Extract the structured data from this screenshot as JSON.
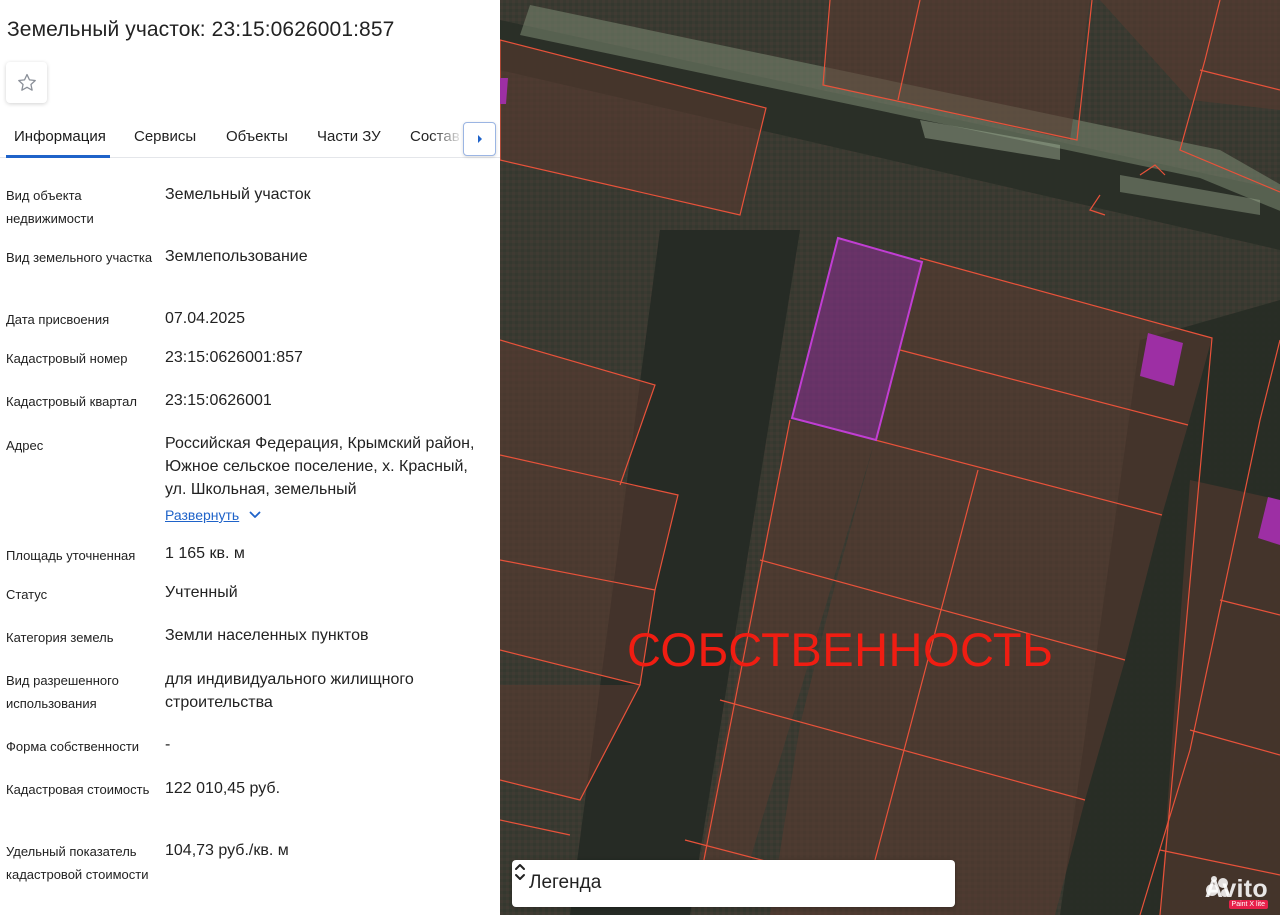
{
  "header": {
    "title": "Земельный участок: 23:15:0626001:857"
  },
  "tabs": [
    {
      "label": "Информация",
      "active": true
    },
    {
      "label": "Сервисы"
    },
    {
      "label": "Объекты"
    },
    {
      "label": "Части ЗУ"
    },
    {
      "label": "Состав"
    }
  ],
  "info": {
    "object_type": {
      "label": "Вид объекта недвижимости",
      "value": "Земельный участок"
    },
    "land_type": {
      "label": "Вид земельного участка",
      "value": "Землепользование"
    },
    "assign_date": {
      "label": "Дата присвоения",
      "value": "07.04.2025"
    },
    "cadastral_number": {
      "label": "Кадастровый номер",
      "value": "23:15:0626001:857"
    },
    "cadastral_quarter": {
      "label": "Кадастровый квартал",
      "value": "23:15:0626001"
    },
    "address": {
      "label": "Адрес",
      "value": "Российская Федерация, Крымский район, Южное сельское поселение, х. Красный, ул. Школьная, земельный",
      "expand_label": "Развернуть"
    },
    "area": {
      "label": "Площадь уточненная",
      "value": "1 165 кв. м"
    },
    "status": {
      "label": "Статус",
      "value": "Учтенный"
    },
    "land_category": {
      "label": "Категория земель",
      "value": "Земли населенных пунктов"
    },
    "permitted_use": {
      "label": "Вид разрешенного использования",
      "value": "для индивидуального жилищного строительства"
    },
    "ownership_form": {
      "label": "Форма собственности",
      "value": "-"
    },
    "cadastral_value": {
      "label": "Кадастровая стоимость",
      "value": "122 010,45 руб."
    },
    "specific_value": {
      "label": "Удельный показатель кадастровой стоимости",
      "value": "104,73 руб./кв. м"
    }
  },
  "map": {
    "overlay_text": "СОБСТВЕННОСТЬ",
    "legend_label": "Легенда",
    "watermark": "Avito",
    "watermark_badge": "Paint X lite"
  },
  "colors": {
    "accent": "#1f63c9",
    "parcel_border": "#e8523a",
    "selected_parcel": "#b43cc8",
    "overlay_text": "#f01d12"
  },
  "icons": {
    "favorite": "star-outline-icon",
    "tabs_next": "caret-right-icon",
    "expand": "chevron-down-icon",
    "legend_toggle": "unfold-icon"
  }
}
